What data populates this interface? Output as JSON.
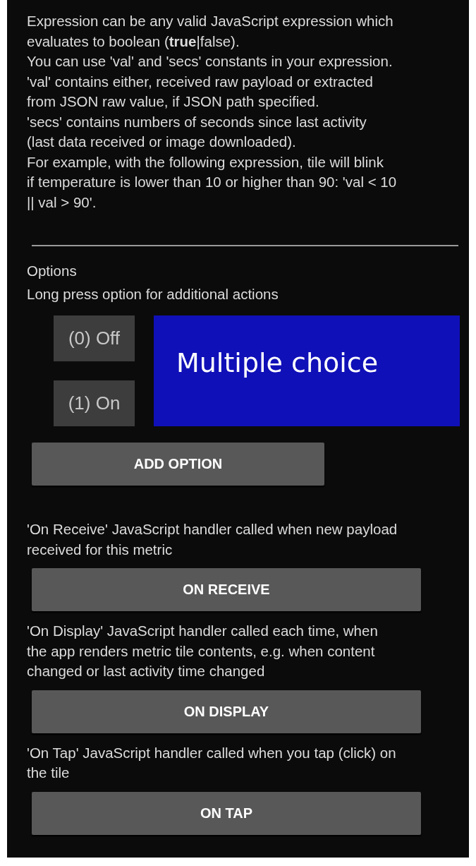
{
  "description": "Expression can be any valid JavaScript expression which\nevaluates to boolean (**true**|false).\nYou can use 'val' and 'secs' constants in your expression.\n'val' contains either, received raw payload or extracted\nfrom JSON raw value, if JSON path specified.\n'secs' contains numbers of seconds since last activity\n(last data received or image downloaded).\nFor example, with the following expression, tile will blink\nif temperature is lower than 10 or higher than 90: 'val < 10\n|| val > 90'.",
  "options": {
    "title": "Options",
    "hint": "Long press option for additional actions",
    "items": [
      "(0) Off",
      "(1) On"
    ],
    "preview": "Multiple choice",
    "add_button": "ADD OPTION"
  },
  "handlers": [
    {
      "description": "'On Receive' JavaScript handler called when new payload\nreceived for this metric",
      "button": "ON RECEIVE"
    },
    {
      "description": "'On Display' JavaScript handler called each time, when\nthe app renders metric tile contents, e.g. when content\nchanged or last activity time changed",
      "button": "ON DISPLAY"
    },
    {
      "description": "'On Tap' JavaScript handler called when you tap (click) on\nthe tile",
      "button": "ON TAP"
    }
  ]
}
